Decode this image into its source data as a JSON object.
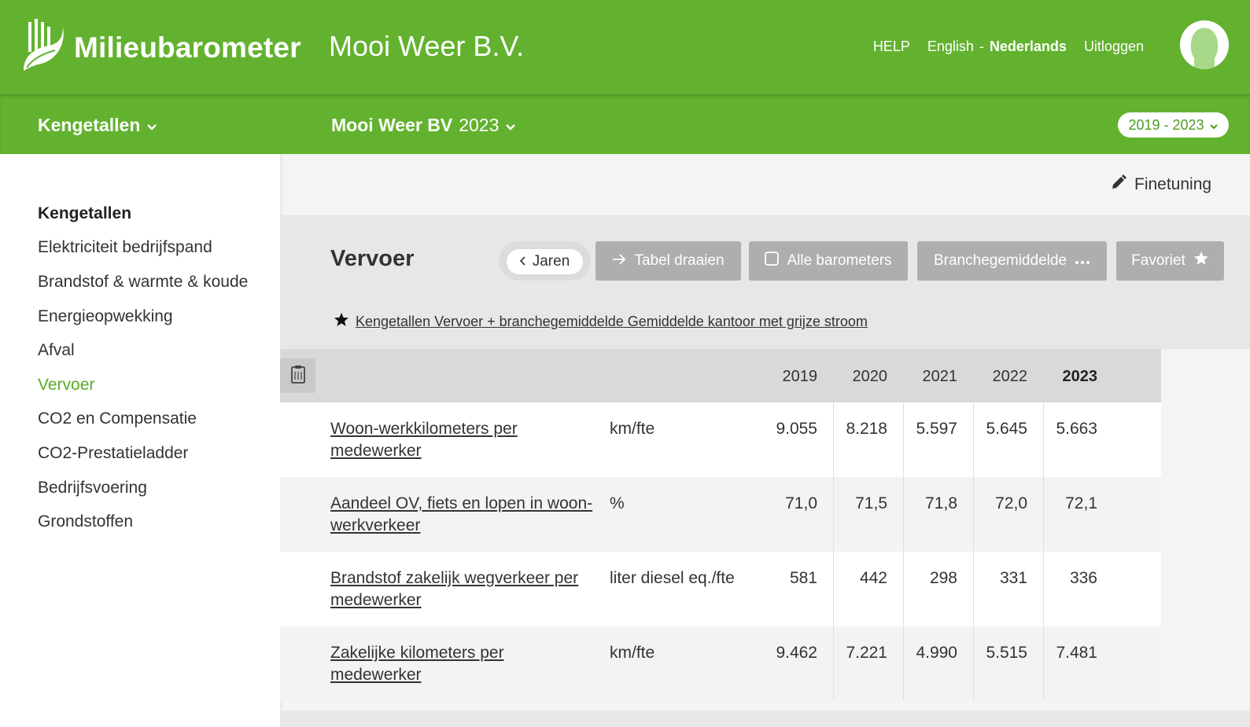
{
  "header": {
    "logo_text": "Milieubarometer",
    "company": "Mooi Weer B.V.",
    "help": "HELP",
    "lang_en": "English",
    "lang_sep": "-",
    "lang_nl": "Nederlands",
    "logout": "Uitloggen"
  },
  "subbar": {
    "section": "Kengetallen",
    "org_name": "Mooi Weer BV",
    "org_year": "2023",
    "range": "2019 - 2023"
  },
  "sidebar": {
    "heading": "Kengetallen",
    "items": [
      "Elektriciteit bedrijfspand",
      "Brandstof & warmte & koude",
      "Energieopwekking",
      "Afval",
      "Vervoer",
      "CO2 en Compensatie",
      "CO2-Prestatieladder",
      "Bedrijfsvoering",
      "Grondstoffen"
    ],
    "active_index": 4
  },
  "main": {
    "finetuning": "Finetuning",
    "title": "Vervoer",
    "buttons": {
      "jaren": "Jaren",
      "tabel": "Tabel draaien",
      "alle": "Alle barometers",
      "branche": "Branchegemiddelde",
      "favoriet": "Favoriet"
    },
    "favorite_link": "Kengetallen Vervoer + branchegemiddelde Gemiddelde kantoor met grijze stroom"
  },
  "table": {
    "years": [
      "2019",
      "2020",
      "2021",
      "2022",
      "2023"
    ],
    "rows": [
      {
        "label": "Woon-werkkilometers per medewerker",
        "unit": "km/fte",
        "values": [
          "9.055",
          "8.218",
          "5.597",
          "5.645",
          "5.663"
        ]
      },
      {
        "label": "Aandeel OV, fiets en lopen in woon-werkverkeer",
        "unit": "%",
        "values": [
          "71,0",
          "71,5",
          "71,8",
          "72,0",
          "72,1"
        ]
      },
      {
        "label": "Brandstof zakelijk wegverkeer per medewerker",
        "unit": "liter diesel eq./fte",
        "values": [
          "581",
          "442",
          "298",
          "331",
          "336"
        ]
      },
      {
        "label": "Zakelijke kilometers per medewerker",
        "unit": "km/fte",
        "values": [
          "9.462",
          "7.221",
          "4.990",
          "5.515",
          "7.481"
        ]
      }
    ]
  },
  "colors": {
    "brand_green": "#63b22f",
    "active_green": "#5aaa25",
    "button_grey": "#aeaeae"
  },
  "icons": {
    "logo": "hand-leaf-icon",
    "avatar": "user-avatar-icon",
    "chevron": "chevron-down-icon",
    "pencil": "pencil-icon",
    "back": "chevron-left-icon",
    "arrow": "arrow-right-icon",
    "checkbox": "checkbox-icon",
    "more": "ellipsis-icon",
    "star": "star-icon",
    "clipboard": "clipboard-icon"
  }
}
